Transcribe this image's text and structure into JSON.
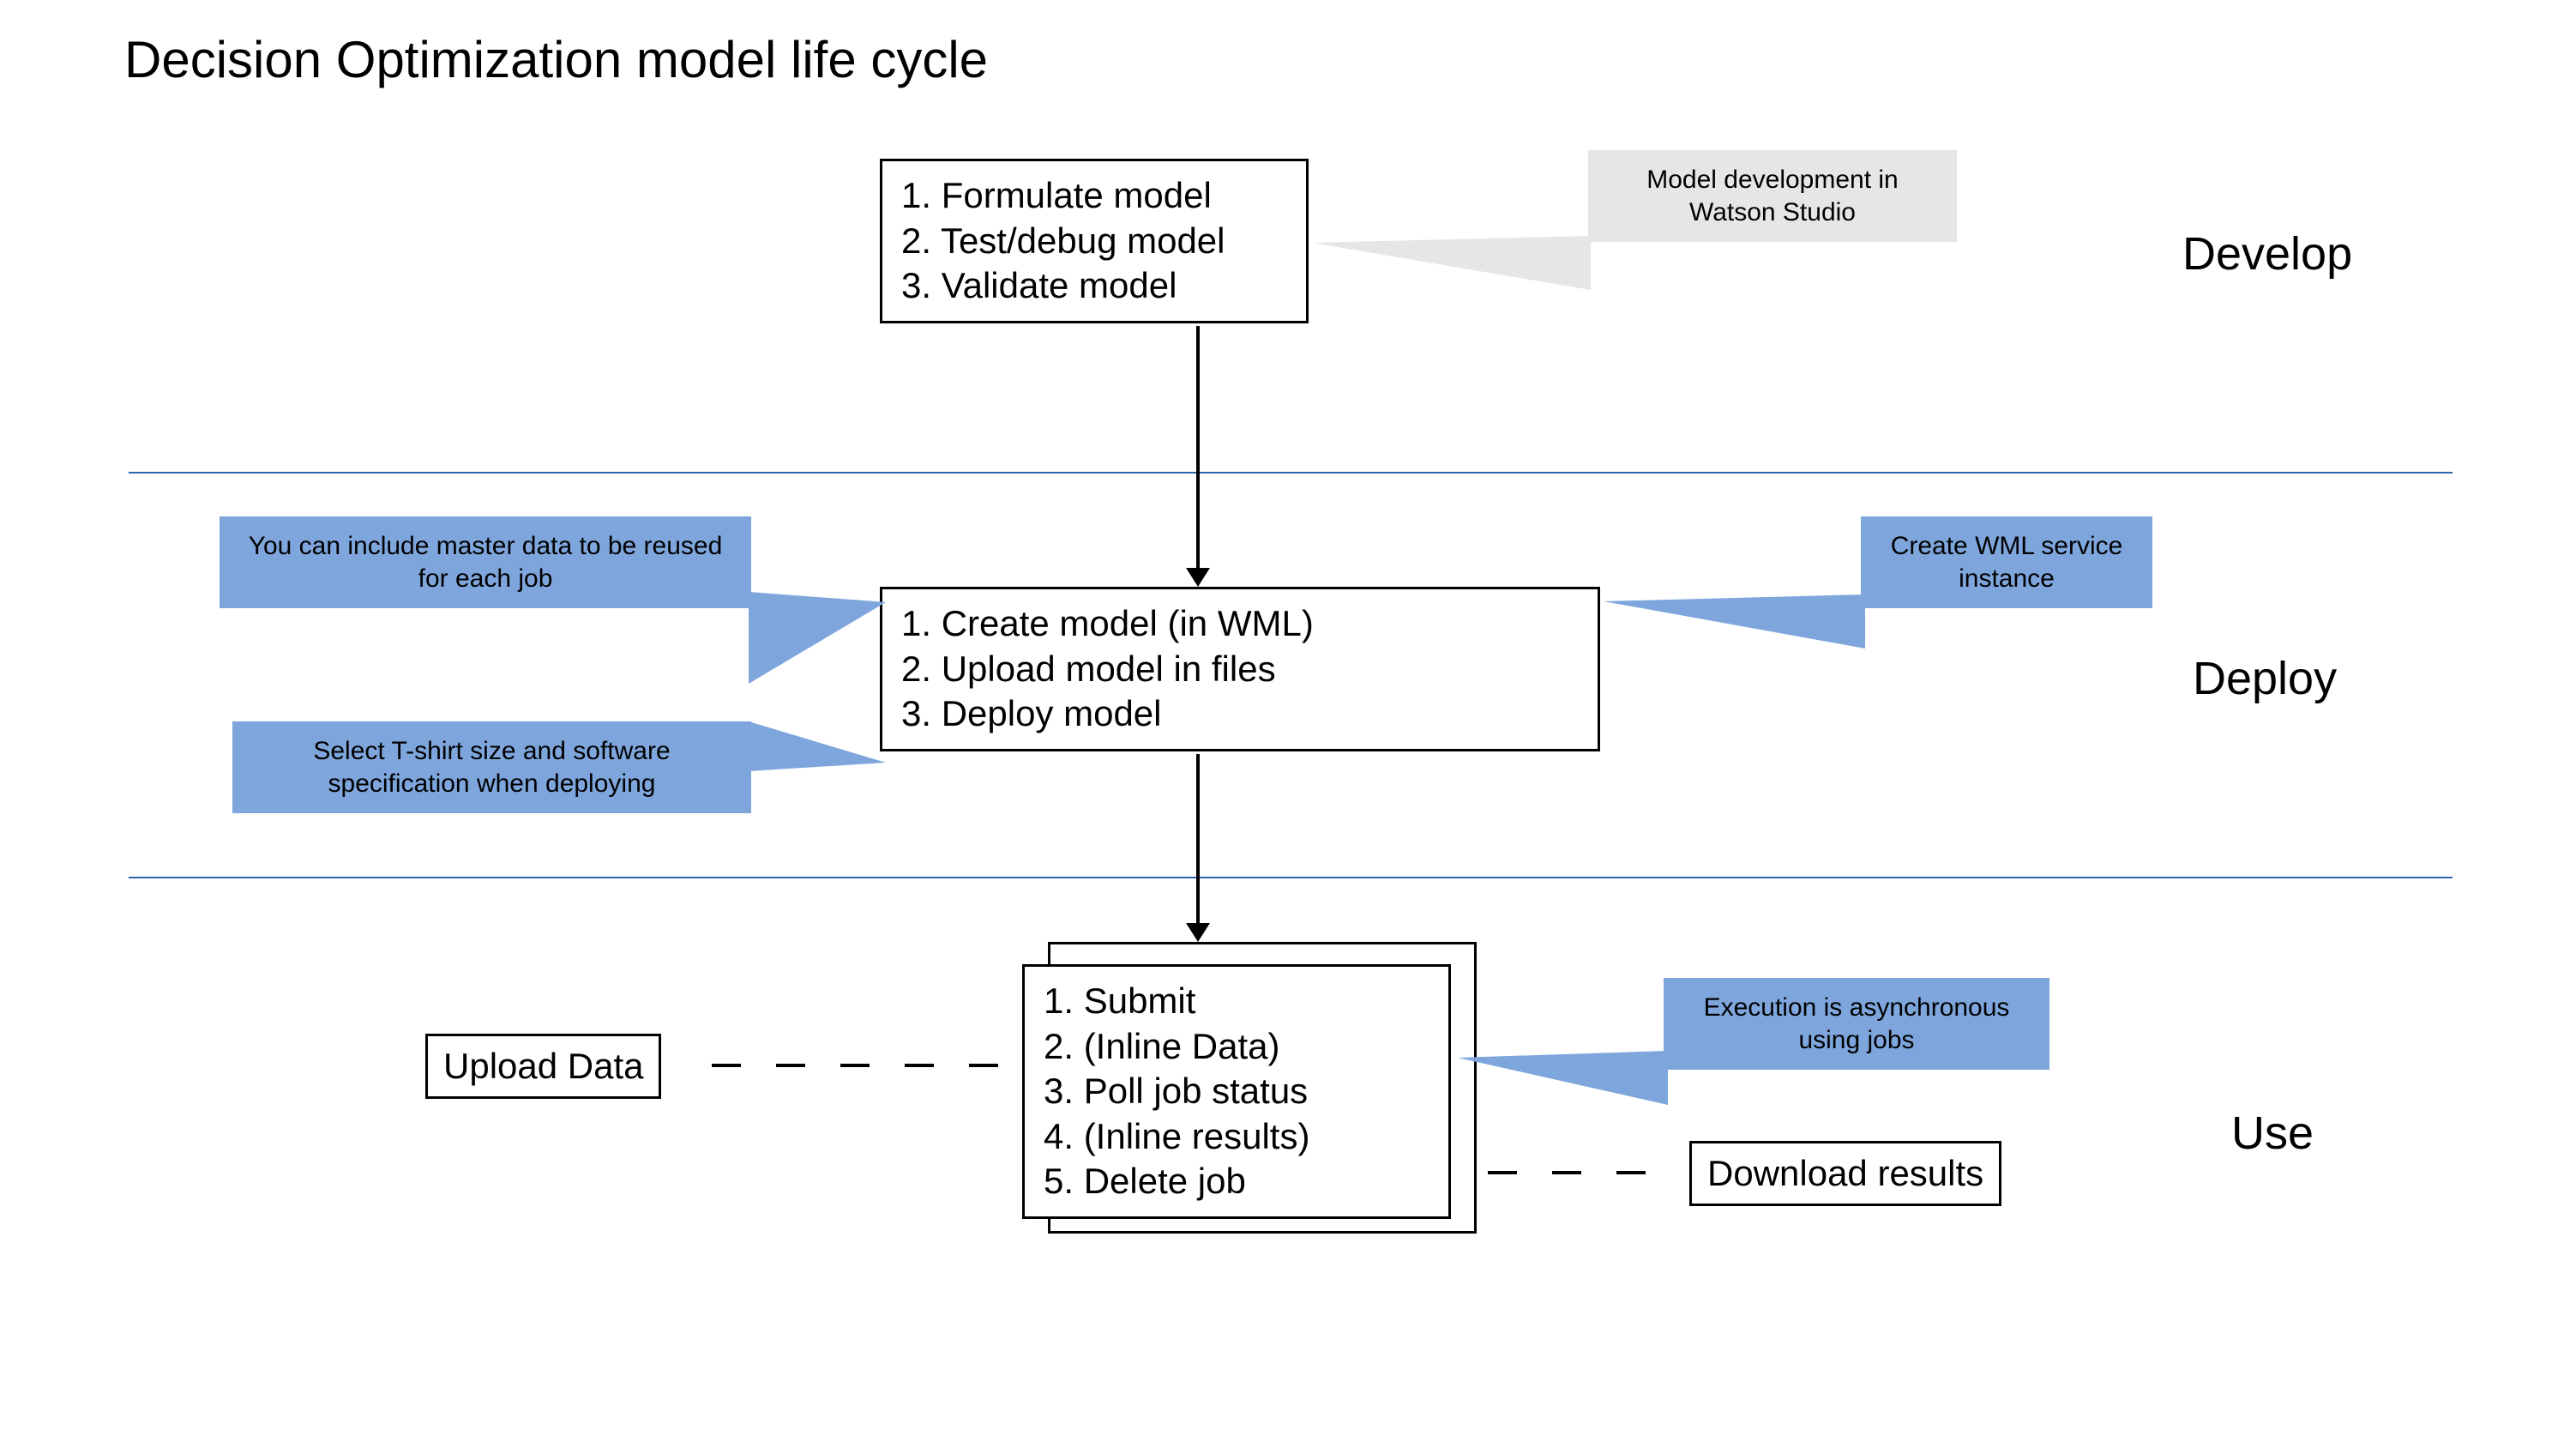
{
  "title": "Decision Optimization model life cycle",
  "phases": {
    "develop": "Develop",
    "deploy": "Deploy",
    "use": "Use"
  },
  "boxes": {
    "develop": {
      "l1": "1. Formulate model",
      "l2": "2. Test/debug model",
      "l3": "3. Validate model"
    },
    "deploy": {
      "l1": "1. Create model (in WML)",
      "l2": "2. Upload model in files",
      "l3": "3. Deploy model"
    },
    "use": {
      "l1": "1. Submit",
      "l2": "2. (Inline Data)",
      "l3": "3. Poll job status",
      "l4": "4. (Inline results)",
      "l5": "5. Delete job"
    },
    "upload": "Upload Data",
    "download": "Download results"
  },
  "callouts": {
    "watson_studio": "Model development in Watson Studio",
    "master_data": "You can include master data to be reused for each job",
    "tshirt": "Select T-shirt size and software specification when deploying",
    "wml_service": "Create WML service instance",
    "async": "Execution is asynchronous using jobs"
  },
  "colors": {
    "callout_blue": "#7ea6dd",
    "callout_grey": "#e6e6e6",
    "separator": "#2f64b0"
  }
}
